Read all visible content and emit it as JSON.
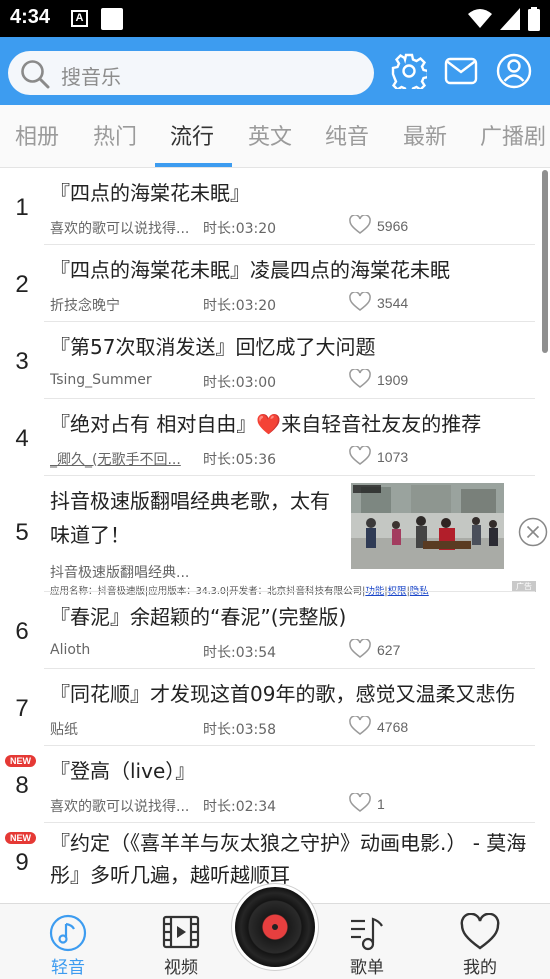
{
  "status_bar": {
    "time": "4:34",
    "notification_letter": "A"
  },
  "search": {
    "placeholder": "搜音乐"
  },
  "header_icons": [
    "gear-icon",
    "mail-icon",
    "user-icon"
  ],
  "tabs": [
    {
      "label": "相册",
      "active": false
    },
    {
      "label": "热门",
      "active": false
    },
    {
      "label": "流行",
      "active": true
    },
    {
      "label": "英文",
      "active": false
    },
    {
      "label": "纯音",
      "active": false
    },
    {
      "label": "最新",
      "active": false
    },
    {
      "label": "广播剧",
      "active": false
    }
  ],
  "songs": [
    {
      "rank": "1",
      "title": "『四点的海棠花未眠』",
      "artist": "喜欢的歌可以说找得...",
      "duration": "时长:03:20",
      "likes": "5966"
    },
    {
      "rank": "2",
      "title": "『四点的海棠花未眠』凌晨四点的海棠花未眠",
      "artist": "折技念晚宁",
      "duration": "时长:03:20",
      "likes": "3544"
    },
    {
      "rank": "3",
      "title": "『第57次取消发送』回忆成了大问题",
      "artist": "Tsing_Summer",
      "duration": "时长:03:00",
      "likes": "1909"
    },
    {
      "rank": "4",
      "title": "『绝对占有 相对自由』❤️来自轻音社友友的推荐",
      "artist": "_卿久_(无歌手不回...",
      "duration": "时长:05:36",
      "likes": "1073"
    },
    {
      "rank": "6",
      "title": "『春泥』余超颖的“春泥”(完整版)",
      "artist": "Alioth",
      "duration": "时长:03:54",
      "likes": "627"
    },
    {
      "rank": "7",
      "title": "『同花顺』才发现这首09年的歌，感觉又温柔又悲伤",
      "artist": "贴纸",
      "duration": "时长:03:58",
      "likes": "4768"
    },
    {
      "rank": "8",
      "title": "『登高（live）』",
      "artist": "喜欢的歌可以说找得...",
      "duration": "时长:02:34",
      "likes": "1",
      "badge": "NEW"
    },
    {
      "rank": "9",
      "title": "『约定（《喜羊羊与灰太狼之守护》动画电影.） - 莫海彤』多听几遍，越听越顺耳",
      "badge": "NEW"
    }
  ],
  "ad": {
    "rank": "5",
    "title": "抖音极速版翻唱经典老歌，太有味道了！",
    "subtitle": "抖音极速版翻唱经典...",
    "meta": "应用名称：抖音极速版|应用版本：34.3.0|开发者：北京抖音科技有限公司|",
    "links": [
      "功能",
      "权限",
      "隐私"
    ],
    "tag": "广告"
  },
  "bottom_nav": [
    {
      "label": "轻音",
      "icon": "music-note-icon",
      "active": true
    },
    {
      "label": "视频",
      "icon": "film-icon",
      "active": false
    },
    {
      "label": "歌单",
      "icon": "playlist-icon",
      "active": false
    },
    {
      "label": "我的",
      "icon": "heart-icon",
      "active": false
    }
  ],
  "colors": {
    "accent": "#3d9cf0",
    "header_bg": "#3d9cf0",
    "badge": "#e53935",
    "disc_center": "#e63f3f"
  }
}
